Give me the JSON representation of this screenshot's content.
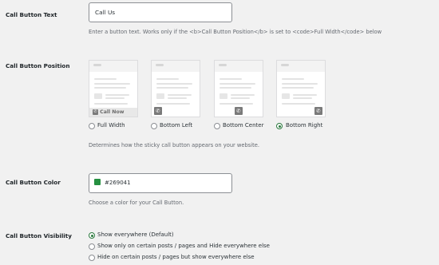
{
  "call_button_text": {
    "label": "Call Button Text",
    "value": "Call Us",
    "description": "Enter a button text. Works only if the <b>Call Button Position</b> is set to <code>Full Width</code> below"
  },
  "call_button_position": {
    "label": "Call Button Position",
    "thumbnail_bar_text": "Call Now",
    "options": [
      {
        "label": "Full Width",
        "checked": false
      },
      {
        "label": "Bottom Left",
        "checked": false
      },
      {
        "label": "Bottom Center",
        "checked": false
      },
      {
        "label": "Bottom Right",
        "checked": true
      }
    ],
    "description": "Determines how the sticky call button appears on your website."
  },
  "call_button_color": {
    "label": "Call Button Color",
    "value": "#269041",
    "swatch": "#269041",
    "description": "Choose a color for your Call Button."
  },
  "call_button_visibility": {
    "label": "Call Button Visibility",
    "options": [
      {
        "label": "Show everywhere (Default)",
        "checked": true
      },
      {
        "label": "Show only on certain posts / pages and Hide everywhere else",
        "checked": false
      },
      {
        "label": "Hide on certain posts / pages but show everywhere else",
        "checked": false
      }
    ]
  }
}
